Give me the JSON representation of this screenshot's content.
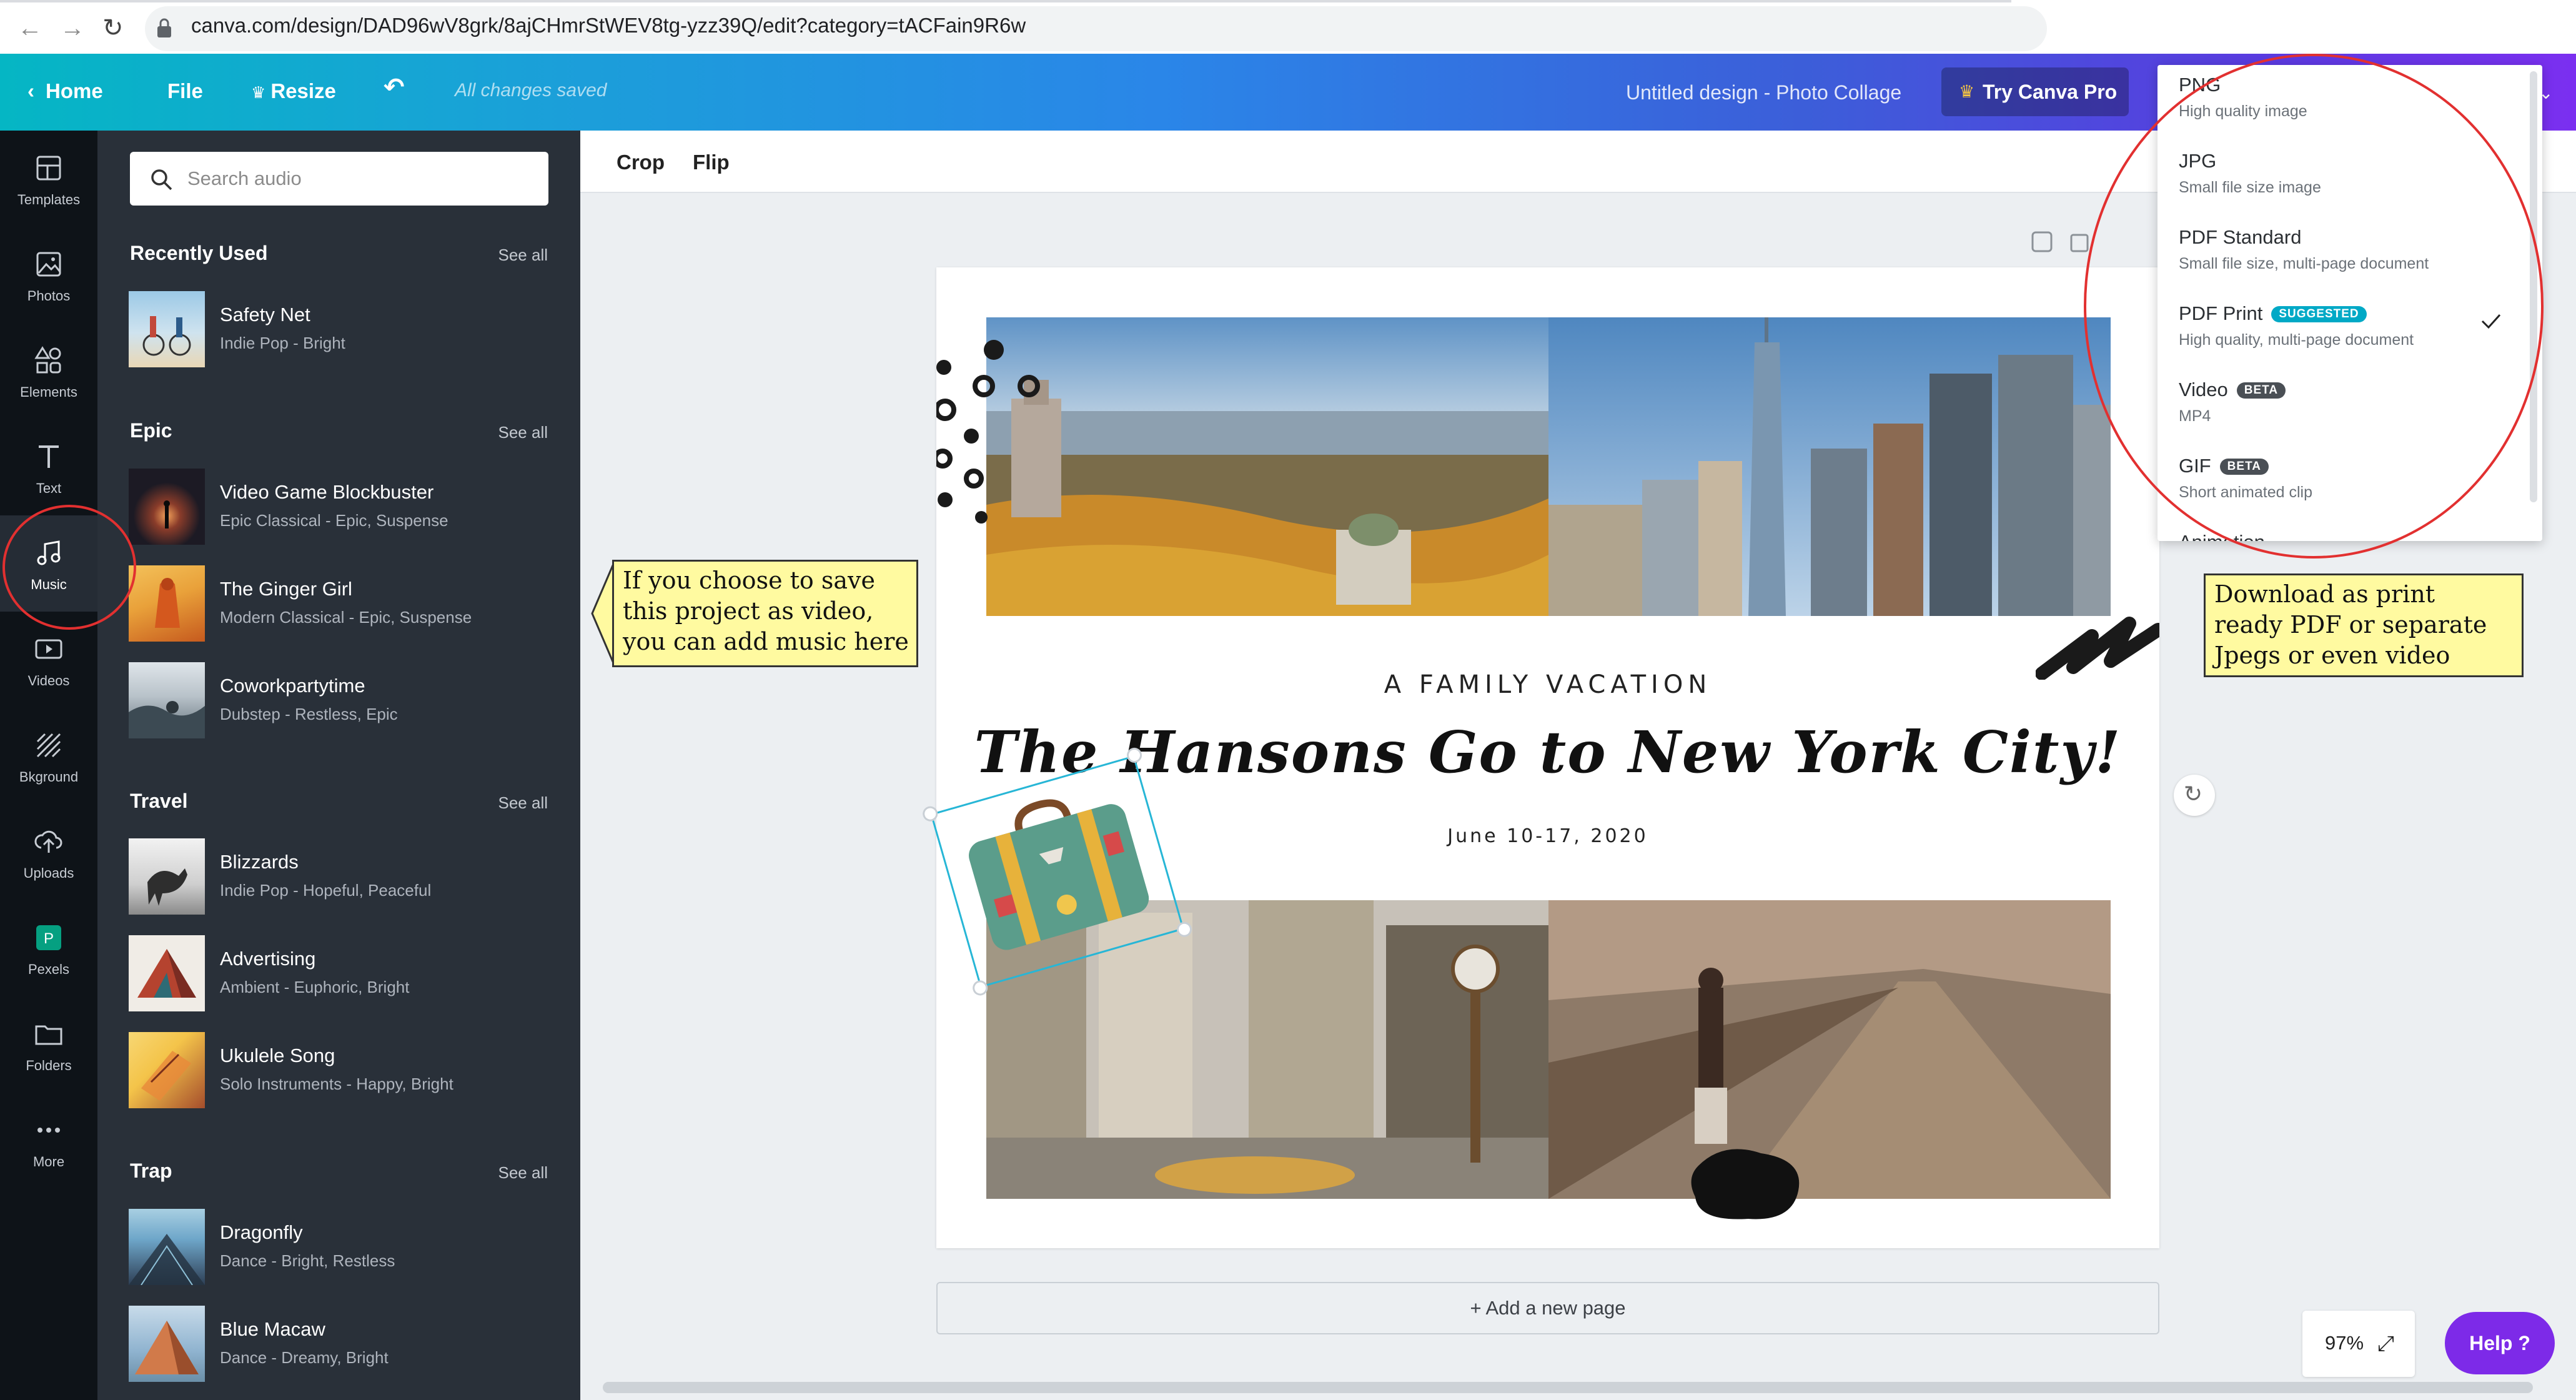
{
  "browser": {
    "url": "canva.com/design/DAD96wV8grk/8ajCHmrStWEV8tg-yzz39Q/edit?category=tACFain9R6w",
    "back_icon": "back-arrow-icon",
    "forward_icon": "forward-arrow-icon",
    "reload_icon": "reload-icon"
  },
  "topbar": {
    "home": "Home",
    "file": "File",
    "resize": "Resize",
    "autosave": "All changes saved",
    "doc_title": "Untitled design - Photo Collage",
    "try_pro": "Try Canva Pro",
    "gradient_start": "#05b6c4",
    "gradient_end": "#7b2ff0"
  },
  "rail": {
    "items": [
      {
        "label": "Templates",
        "icon": "templates-icon"
      },
      {
        "label": "Photos",
        "icon": "photos-icon"
      },
      {
        "label": "Elements",
        "icon": "elements-icon"
      },
      {
        "label": "Text",
        "icon": "text-icon"
      },
      {
        "label": "Music",
        "icon": "music-icon",
        "active": true
      },
      {
        "label": "Videos",
        "icon": "videos-icon"
      },
      {
        "label": "Bkground",
        "icon": "background-icon"
      },
      {
        "label": "Uploads",
        "icon": "uploads-icon"
      },
      {
        "label": "Pexels",
        "icon": "pexels-icon"
      },
      {
        "label": "Folders",
        "icon": "folders-icon"
      },
      {
        "label": "More",
        "icon": "more-icon"
      }
    ]
  },
  "panel": {
    "search_placeholder": "Search audio",
    "see_all": "See all",
    "sections": [
      {
        "title": "Recently Used",
        "tracks": [
          {
            "name": "Safety Net",
            "meta": "Indie Pop - Bright",
            "thumb": [
              "#9cc9e6",
              "#e9d7b5"
            ]
          }
        ]
      },
      {
        "title": "Epic",
        "tracks": [
          {
            "name": "Video Game Blockbuster",
            "meta": "Epic Classical - Epic, Suspense",
            "thumb": [
              "#1c1a24",
              "#e07a3c"
            ]
          },
          {
            "name": "The Ginger Girl",
            "meta": "Modern Classical - Epic, Suspense",
            "thumb": [
              "#e9a13a",
              "#c65a1e"
            ]
          },
          {
            "name": "Coworkpartytime",
            "meta": "Dubstep - Restless, Epic",
            "thumb": [
              "#b8c2c9",
              "#5d6b75"
            ]
          }
        ]
      },
      {
        "title": "Travel",
        "tracks": [
          {
            "name": "Blizzards",
            "meta": "Indie Pop - Hopeful, Peaceful",
            "thumb": [
              "#e3e3e3",
              "#4a4a4a"
            ]
          },
          {
            "name": "Advertising",
            "meta": "Ambient - Euphoric, Bright",
            "thumb": [
              "#f0ece6",
              "#b5432f"
            ]
          },
          {
            "name": "Ukulele Song",
            "meta": "Solo Instruments - Happy, Bright",
            "thumb": [
              "#f4c44a",
              "#a54d2c"
            ]
          }
        ]
      },
      {
        "title": "Trap",
        "tracks": [
          {
            "name": "Dragonfly",
            "meta": "Dance - Bright, Restless",
            "thumb": [
              "#6ea6c9",
              "#2e3f55"
            ]
          },
          {
            "name": "Blue Macaw",
            "meta": "Dance - Dreamy, Bright",
            "thumb": [
              "#8fb3cf",
              "#d17a4a"
            ]
          }
        ]
      }
    ]
  },
  "editor": {
    "toolbar": {
      "crop": "Crop",
      "flip": "Flip"
    },
    "design": {
      "kicker": "A FAMILY VACATION",
      "headline": "The Hansons Go to New York City!",
      "date": "June 10-17, 2020"
    },
    "add_page": "+ Add a new page",
    "zoom": "97%",
    "help": "Help ?"
  },
  "download_menu": {
    "items": [
      {
        "name": "PNG",
        "desc": "High quality image"
      },
      {
        "name": "JPG",
        "desc": "Small file size image"
      },
      {
        "name": "PDF Standard",
        "desc": "Small file size, multi-page document"
      },
      {
        "name": "PDF Print",
        "desc": "High quality, multi-page document",
        "badge": "SUGGESTED",
        "badge_color": "#00a9c6",
        "selected": true
      },
      {
        "name": "Video",
        "desc": "MP4",
        "badge": "BETA",
        "badge_color": "#4a4f55"
      },
      {
        "name": "GIF",
        "desc": "Short animated clip",
        "badge": "BETA",
        "badge_color": "#4a4f55"
      },
      {
        "name": "Animation",
        "desc": ""
      }
    ]
  },
  "annotations": {
    "music_note": [
      "If you choose to save",
      "this project as video,",
      "you can add music here"
    ],
    "download_note": [
      "Download as print",
      "ready PDF or separate",
      "Jpegs or even video"
    ],
    "highlight_color": "#e23030",
    "note_color": "#fffaa0"
  }
}
